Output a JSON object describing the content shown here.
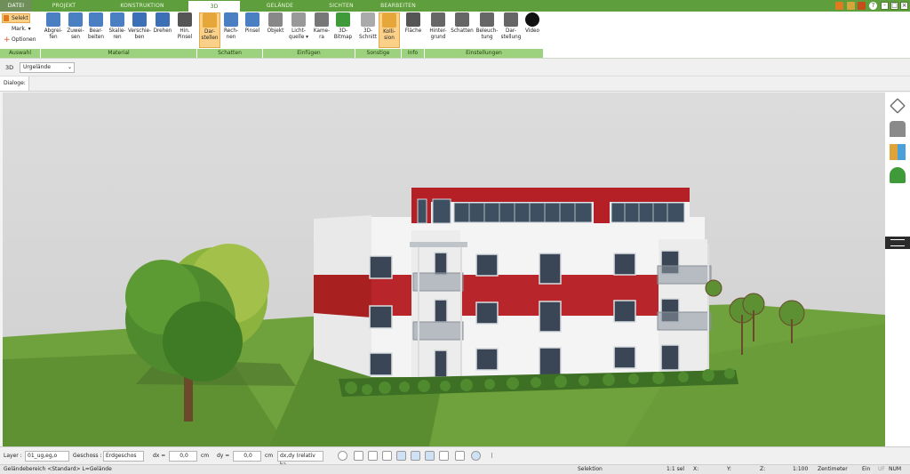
{
  "tabs": [
    "DATEI",
    "PROJEKT",
    "KONSTRUKTION",
    "3D",
    "GELÄNDE",
    "SICHTEN",
    "BEARBEITEN"
  ],
  "ribbon": {
    "auswahl": {
      "select": "Selekt",
      "mark": "Mark.",
      "options": "Optionen",
      "group": "Auswahl"
    },
    "material": {
      "group": "Material",
      "items": [
        "Abgrei-\nfen",
        "Zuwei-\nsen",
        "Bear-\nbeiten",
        "Skalie-\nren",
        "Verschie-\nben",
        "Drehen",
        "Hin.\nPinsel"
      ]
    },
    "schatten": {
      "group": "Schatten",
      "items": [
        "Dar-\nstellen",
        "Rech-\nnen",
        "Pinsel"
      ]
    },
    "einfuegen": {
      "group": "Einfügen",
      "items": [
        "Objekt",
        "Licht-\nquelle ▾",
        "Kame-\nra",
        "3D-\nBitmap"
      ]
    },
    "sonstige": {
      "group": "Sonstige",
      "items": [
        "3D-\nSchnitt",
        "Kolli-\nsion"
      ]
    },
    "info": {
      "group": "Info",
      "items": [
        "Fläche"
      ]
    },
    "einstellungen": {
      "group": "Einstellungen",
      "items": [
        "Hinter-\ngrund",
        "Schatten",
        "Beleuch-\ntung",
        "Dar-\nstellung",
        "Video"
      ]
    }
  },
  "view": {
    "mode": "3D",
    "terrain": "Urgelände"
  },
  "dialoge_label": "Dialoge:",
  "bottom": {
    "layer_label": "Layer :",
    "layer_value": "01_ug,eg,o",
    "geschoss_label": "Geschoss :",
    "geschoss_value": "Erdgeschos",
    "dx_label": "dx =",
    "dx_value": "0,0",
    "dx_unit": "cm",
    "dy_label": "dy =",
    "dy_value": "0,0",
    "dy_unit": "cm",
    "mode_value": "dx,dy (relativ ka"
  },
  "status": {
    "left": "Geländebereich <Standard> L=Gelände",
    "sel": "Selektion",
    "scale": "1:1 sel",
    "x": "X:",
    "y": "Y:",
    "z": "Z:",
    "ratio": "1:100",
    "unit": "Zentimeter",
    "ein": "Ein",
    "uf": "UF",
    "num": "NUM"
  },
  "colors": {
    "ribbon_green": "#5f9e3c",
    "group_green": "#9cd17d",
    "active_button": "#fbd089",
    "facade_red": "#b8262b"
  }
}
